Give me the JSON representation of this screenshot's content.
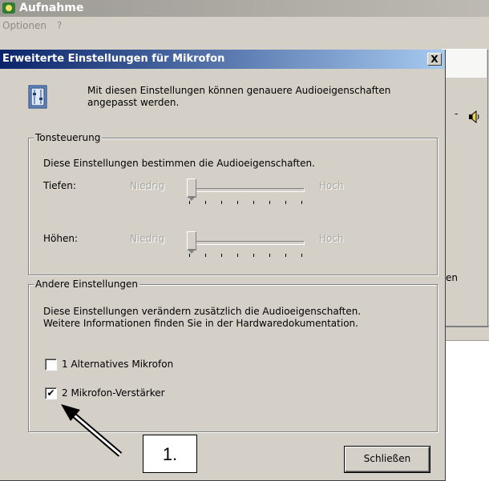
{
  "background_window": {
    "title": "Aufnahme",
    "menu": [
      "Optionen",
      "?"
    ],
    "partial_text_right": "en",
    "partial_arrow": "-"
  },
  "dialog": {
    "title": "Erweiterte Einstellungen für Mikrofon",
    "close_label": "X",
    "intro_text": "Mit diesen Einstellungen können genauere Audioeigenschaften angepasst werden.",
    "tone_group": {
      "label": "Tonsteuerung",
      "description": "Diese Einstellungen bestimmen die Audioeigenschaften.",
      "bass_label": "Tiefen:",
      "treble_label": "Höhen:",
      "low_label": "Niedrig",
      "high_label": "Hoch",
      "bass_level": 0,
      "treble_level": 0,
      "enabled": false
    },
    "other_group": {
      "label": "Andere Einstellungen",
      "description_line1": "Diese Einstellungen verändern zusätzlich die Audioeigenschaften.",
      "description_line2": "Weitere Informationen finden Sie in der Hardwaredokumentation.",
      "checkboxes": [
        {
          "label": "1  Alternatives Mikrofon",
          "checked": false
        },
        {
          "label": "2  Mikrofon-Verstärker",
          "checked": true
        }
      ]
    },
    "close_button_label": "Schließen"
  },
  "annotation": {
    "step_label": "1."
  },
  "colors": {
    "window_bg": "#d4d0c8",
    "active_title_start": "#0a246a",
    "active_title_end": "#a6caf0",
    "inactive_title": "#9c9a94",
    "disabled_text": "#a8a6a0"
  }
}
